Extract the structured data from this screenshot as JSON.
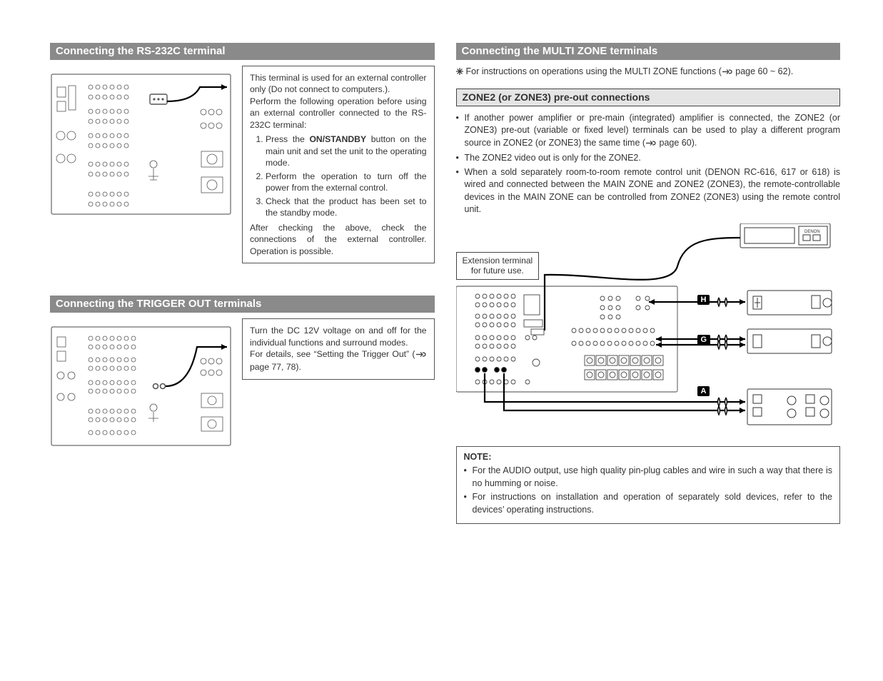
{
  "left": {
    "rs232": {
      "heading": "Connecting the RS-232C terminal",
      "p1": "This terminal is used for an external controller only (Do not connect to computers.).",
      "p2": "Perform the following operation before using an external controller connected to the RS-232C terminal:",
      "step1a": "Press the ",
      "step1_btn": "ON/STANDBY",
      "step1b": " button on the main unit and set the unit to the operating mode.",
      "step2": "Perform the operation to turn off the power from the external control.",
      "step3": "Check that the product has been set to the standby mode.",
      "p3": "After checking the above, check the connections of the external controller. Operation is possible."
    },
    "trigger": {
      "heading": "Connecting the TRIGGER OUT terminals",
      "p1": "Turn the DC 12V voltage on and off for the individual functions and surround modes.",
      "p2a": "For details, see “Setting the Trigger Out” (",
      "p2b": " page 77, 78)."
    }
  },
  "right": {
    "multizone": {
      "heading": "Connecting the MULTI ZONE terminals",
      "intro_a": "For instructions on operations using the MULTI ZONE functions (",
      "intro_b": " page 60 ~ 62)."
    },
    "zone2": {
      "subheading": "ZONE2 (or ZONE3) pre-out connections",
      "b1a": "If another power amplifier or pre-main (integrated) amplifier is connected, the ZONE2 (or ZONE3) pre-out (variable or fixed level) terminals can be used to play a different program source in ZONE2 (or ZONE3) the same time (",
      "b1b": " page 60).",
      "b2": "The ZONE2 video out is only for the ZONE2.",
      "b3": "When a sold separately room-to-room remote control unit (DENON RC-616, 617 or 618) is wired and connected between the MAIN ZONE and ZONE2 (ZONE3), the remote-controllable devices in the MAIN ZONE can be controlled from ZONE2 (ZONE3) using the remote control unit.",
      "ext_label_l1": "Extension terminal",
      "ext_label_l2": "for future use.",
      "lbl_H": "H",
      "lbl_G": "G",
      "lbl_A": "A"
    },
    "note": {
      "title": "NOTE:",
      "n1": "For the AUDIO output, use high quality pin-plug cables and wire in such a way that there is no humming or noise.",
      "n2": "For instructions on installation and operation of separately sold devices, refer to the devices’ operating instructions."
    }
  }
}
